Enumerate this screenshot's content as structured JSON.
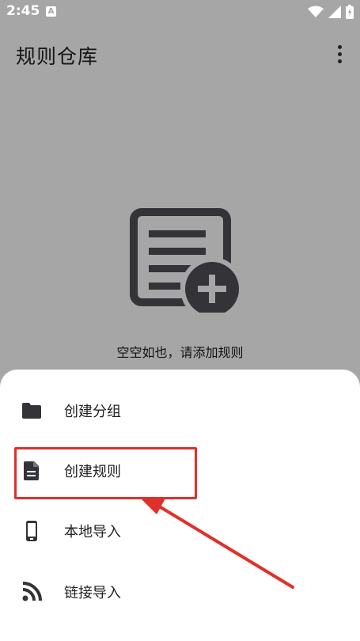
{
  "status_bar": {
    "time": "2:45",
    "app_badge": "A",
    "icons": [
      "wifi-icon",
      "signal-icon",
      "battery-icon"
    ]
  },
  "app_bar": {
    "title": "规则仓库",
    "menu_icon": "more-vert-icon"
  },
  "empty_state": {
    "icon": "note-add-icon",
    "message": "空空如也，请添加规则"
  },
  "bottom_sheet": {
    "items": [
      {
        "label": "创建分组",
        "icon": "folder-icon"
      },
      {
        "label": "创建规则",
        "icon": "file-icon"
      },
      {
        "label": "本地导入",
        "icon": "phone-icon"
      },
      {
        "label": "链接导入",
        "icon": "rss-icon"
      }
    ]
  },
  "annotation": {
    "highlighted_item": "创建规则",
    "color": "#e0302a"
  },
  "colors": {
    "scrim": "#a6a6a6",
    "sheet": "#ffffff",
    "icon": "#333338",
    "accent": "#e0302a"
  }
}
